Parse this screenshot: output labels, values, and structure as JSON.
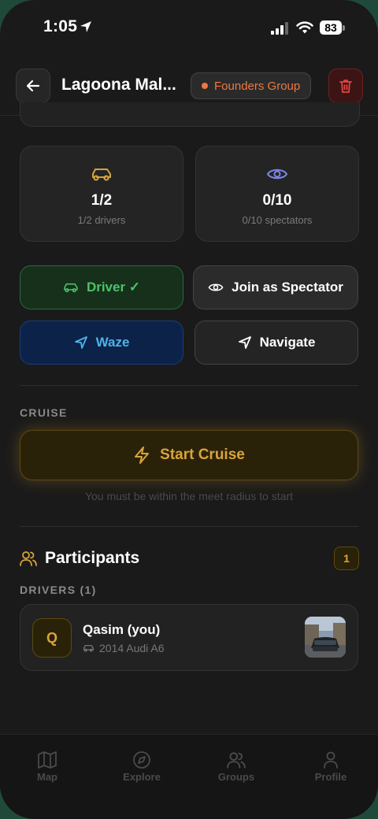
{
  "status": {
    "time": "1:05",
    "battery": "83"
  },
  "header": {
    "title": "Lagoona Mal...",
    "group": "Founders Group"
  },
  "stats": [
    {
      "value": "1/2",
      "label": "1/2 drivers",
      "icon": "car-icon",
      "color": "#d9a43a"
    },
    {
      "value": "0/10",
      "label": "0/10 spectators",
      "icon": "eye-icon",
      "color": "#7b86e8"
    }
  ],
  "actions": {
    "driver": "Driver ✓",
    "spectator": "Join as Spectator",
    "waze": "Waze",
    "navigate": "Navigate"
  },
  "cruise": {
    "section": "CRUISE",
    "start": "Start Cruise",
    "note": "You must be within the meet radius to start"
  },
  "participants": {
    "title": "Participants",
    "count": "1",
    "drivers_label": "DRIVERS (1)",
    "drivers": [
      {
        "initial": "Q",
        "name": "Qasim (you)",
        "car": "2014 Audi A6"
      }
    ]
  },
  "tabs": [
    "Map",
    "Explore",
    "Groups",
    "Profile"
  ],
  "colors": {
    "accent": "#d9a43a",
    "danger": "#e04646",
    "success": "#4cc464",
    "waze": "#4db4ea",
    "group": "#f07840"
  }
}
